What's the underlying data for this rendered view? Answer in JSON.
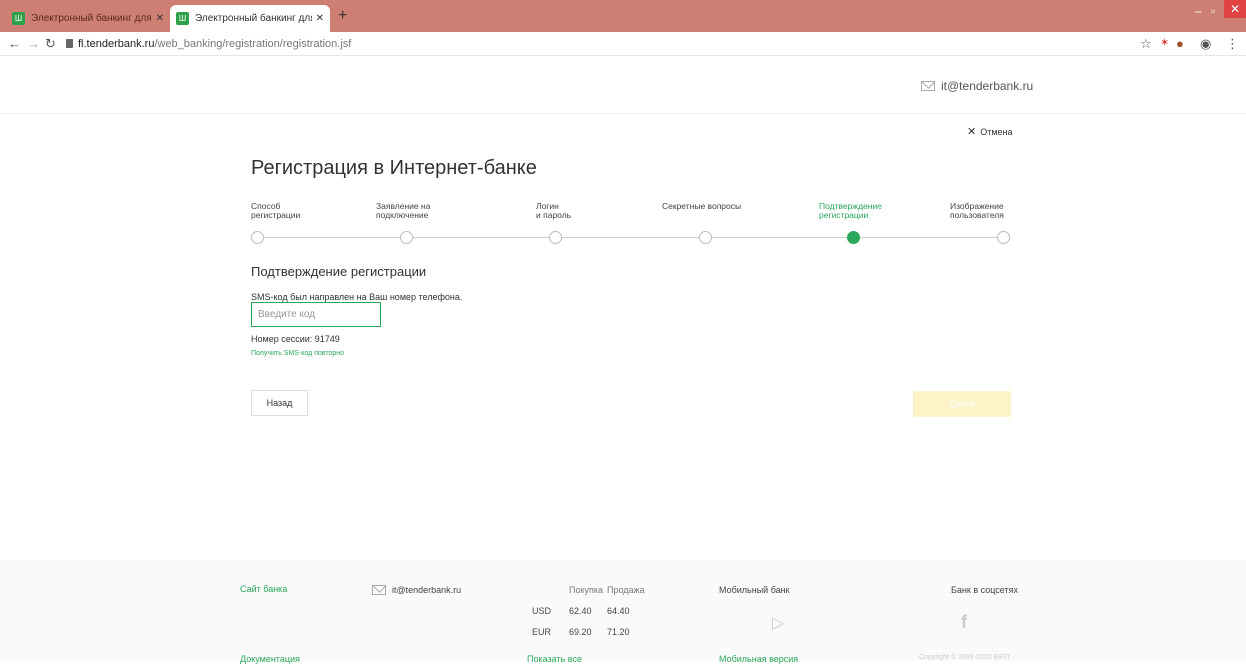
{
  "browser": {
    "tabs": [
      {
        "title": "Электронный банкинг для част"
      },
      {
        "title": "Электронный банкинг для част"
      }
    ],
    "url_host": "fl.tenderbank.ru",
    "url_path": "/web_banking/registration/registration.jsf"
  },
  "header": {
    "email": "it@tenderbank.ru",
    "cancel_label": "Отмена"
  },
  "page": {
    "title": "Регистрация в Интернет-банке"
  },
  "steps": [
    {
      "line1": "Способ",
      "line2": "регистрации",
      "active": false
    },
    {
      "line1": "Заявление на",
      "line2": "подключение",
      "active": false
    },
    {
      "line1": "Логин",
      "line2": "и пароль",
      "active": false
    },
    {
      "line1": "Секретные вопросы",
      "line2": "",
      "active": false
    },
    {
      "line1": "Подтверждение",
      "line2": "регистрации",
      "active": true
    },
    {
      "line1": "Изображение",
      "line2": "пользователя",
      "active": false
    }
  ],
  "confirmation": {
    "title": "Подтверждение регистрации",
    "sms_text": "SMS-код был направлен на Ваш номер телефона.",
    "code_placeholder": "Введите код",
    "session_text": "Номер сессии: 91749",
    "resend_link": "Получить SMS-код повторно"
  },
  "buttons": {
    "back": "Назад",
    "next": "Далее"
  },
  "footer": {
    "site_link": "Сайт банка",
    "docs_link": "Документация",
    "email": "it@tenderbank.ru",
    "rates": {
      "buy_header": "Покупка",
      "sell_header": "Продажа",
      "rows": [
        {
          "currency": "USD",
          "buy": "62.40",
          "sell": "64.40"
        },
        {
          "currency": "EUR",
          "buy": "69.20",
          "sell": "71.20"
        }
      ],
      "show_all": "Показать все"
    },
    "mobile_bank": "Мобильный банк",
    "mobile_version": "Мобильная версия",
    "social": "Банк в соцсетях",
    "copyright": "Copyright © 1999-2020 BIFIT"
  },
  "colors": {
    "accent": "#2aa75b",
    "tabbar": "#cd7f73",
    "next_disabled": "#fdf2c8"
  }
}
